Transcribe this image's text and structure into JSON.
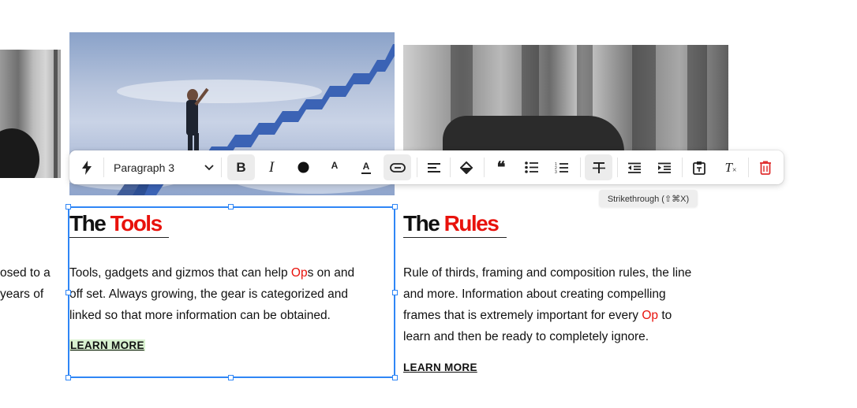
{
  "toolbar": {
    "paragraph_style": "Paragraph 3",
    "bold_glyph": "B",
    "italic_glyph": "I",
    "font_size_glyph": "A",
    "text_color_glyph": "A",
    "quote_glyph": "❝",
    "clear_format_glyph": "T",
    "tooltip": "Strikethrough (⇧⌘X)",
    "icons": [
      "lightning-icon",
      "chevron-down-icon",
      "bold-icon",
      "italic-icon",
      "color-dot-icon",
      "font-size-icon",
      "text-color-icon",
      "link-icon",
      "align-left-icon",
      "fill-icon",
      "quote-icon",
      "bullet-list-icon",
      "numbered-list-icon",
      "strikethrough-icon",
      "outdent-icon",
      "indent-icon",
      "paste-text-icon",
      "clear-format-icon",
      "trash-icon"
    ],
    "colors": {
      "delete": "#e03030",
      "active_bg": "#ececec"
    }
  },
  "left_fragment": {
    "line1": "osed to a",
    "line2": "years of"
  },
  "tools_card": {
    "title_a": "The ",
    "title_b": "Tools",
    "body_1": "Tools, gadgets and gizmos that can help ",
    "body_highlight": "Op",
    "body_2": "s on and",
    "body_line2": "off set. Always growing, the gear is categorized and",
    "body_line3": "linked so that more information can be obtained.",
    "learn_more": "LEARN MORE"
  },
  "rules_card": {
    "title_a": "The ",
    "title_b": "Rules",
    "line1": "Rule of thirds, framing and composition rules, the line",
    "line2": "and more. Information about creating compelling",
    "line3a": "frames that is extremely important for every ",
    "line3_highlight": "Op",
    "line3b": " to",
    "line4": "learn and then be ready to completely ignore.",
    "learn_more": "LEARN MORE"
  },
  "colors": {
    "accent": "#e8120c",
    "selection": "#2f86f6",
    "learn_highlight": "#d9f2d0"
  }
}
